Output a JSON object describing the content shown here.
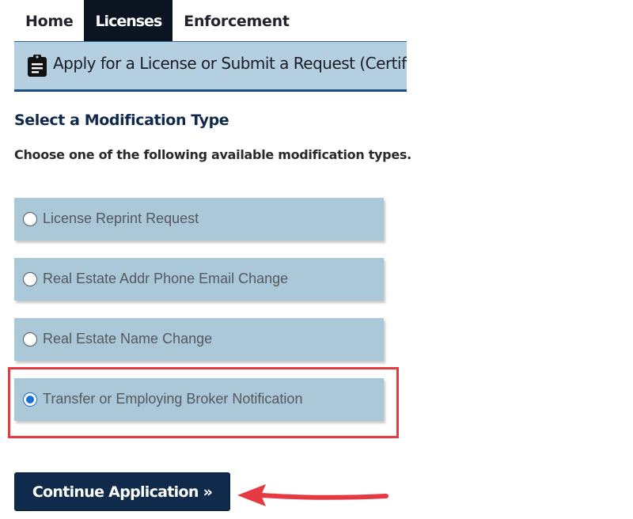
{
  "nav": {
    "tabs": [
      {
        "label": "Home",
        "active": false
      },
      {
        "label": "Licenses",
        "active": true
      },
      {
        "label": "Enforcement",
        "active": false
      }
    ]
  },
  "banner": {
    "icon": "clipboard-icon",
    "text": "Apply for a License or Submit a Request (Certified"
  },
  "section": {
    "title": "Select a Modification Type",
    "instruction": "Choose one of the following available modification types."
  },
  "options": [
    {
      "label": "License Reprint Request",
      "selected": false
    },
    {
      "label": "Real Estate Addr Phone Email Change",
      "selected": false
    },
    {
      "label": "Real Estate Name Change",
      "selected": false
    },
    {
      "label": "Transfer or Employing Broker Notification",
      "selected": true
    }
  ],
  "continue_button": {
    "label": "Continue Application »"
  },
  "annotations": {
    "highlight_color": "#e53a41",
    "arrow_color": "#e53a41"
  },
  "colors": {
    "nav_active_bg": "#0b1522",
    "banner_bg": "#b4cfe0",
    "option_bg": "#abc8d9",
    "button_bg": "#0f2a4a",
    "title_color": "#10294a"
  }
}
